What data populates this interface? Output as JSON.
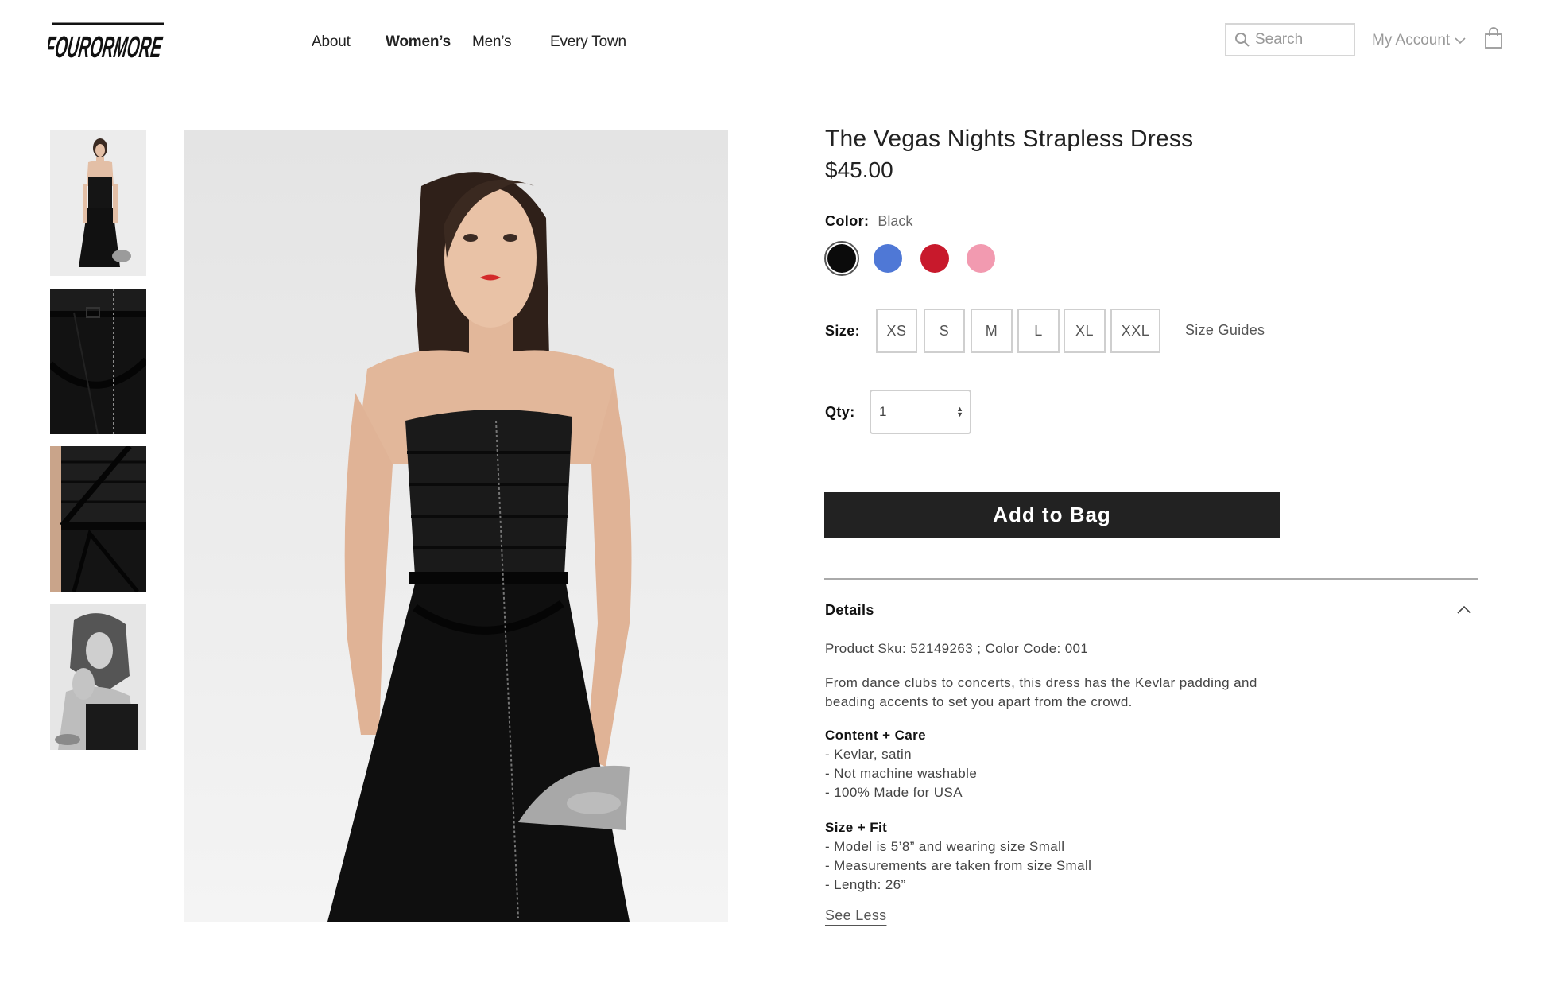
{
  "header": {
    "logo_text": "FOURORMORE",
    "nav": [
      {
        "label": "About",
        "active": false
      },
      {
        "label": "Women’s",
        "active": true
      },
      {
        "label": "Men’s",
        "active": false
      },
      {
        "label": "Every Town",
        "active": false
      }
    ],
    "search_placeholder": "Search",
    "account_label": "My Account",
    "icons": [
      "search-icon",
      "chevron-down-icon",
      "shopping-bag-icon"
    ]
  },
  "gallery": {
    "thumbnails": [
      "full-length-front",
      "bodice-detail",
      "strap-detail",
      "black-and-white-portrait"
    ],
    "main_image": "model-in-black-strapless-dress"
  },
  "product": {
    "title": "The Vegas Nights Strapless Dress",
    "price": "$45.00",
    "color_label": "Color:",
    "color_selected": "Black",
    "colors": [
      {
        "name": "Black",
        "hex": "#0b0b0b",
        "selected": true
      },
      {
        "name": "Blue",
        "hex": "#4f78d6",
        "selected": false
      },
      {
        "name": "Red",
        "hex": "#c8192c",
        "selected": false
      },
      {
        "name": "Pink",
        "hex": "#f29ab0",
        "selected": false
      }
    ],
    "size_label": "Size:",
    "sizes": [
      "XS",
      "S",
      "M",
      "L",
      "XL",
      "XXL"
    ],
    "size_guides_label": "Size Guides",
    "qty_label": "Qty:",
    "qty_value": "1",
    "add_to_bag_label": "Add to Bag"
  },
  "details": {
    "title": "Details",
    "sku_line": "Product Sku: 52149263 ; Color Code: 001",
    "description": "From dance clubs to concerts, this dress has the Kevlar padding and beading accents to set you apart from the crowd.",
    "content_care": {
      "heading": "Content + Care",
      "items": [
        "- Kevlar, satin",
        "- Not machine washable",
        "- 100% Made for USA"
      ]
    },
    "size_fit": {
      "heading": "Size + Fit",
      "items": [
        "- Model is 5’8” and wearing size Small",
        "- Measurements are taken from size Small",
        "- Length: 26”"
      ]
    },
    "see_less_label": "See Less"
  }
}
